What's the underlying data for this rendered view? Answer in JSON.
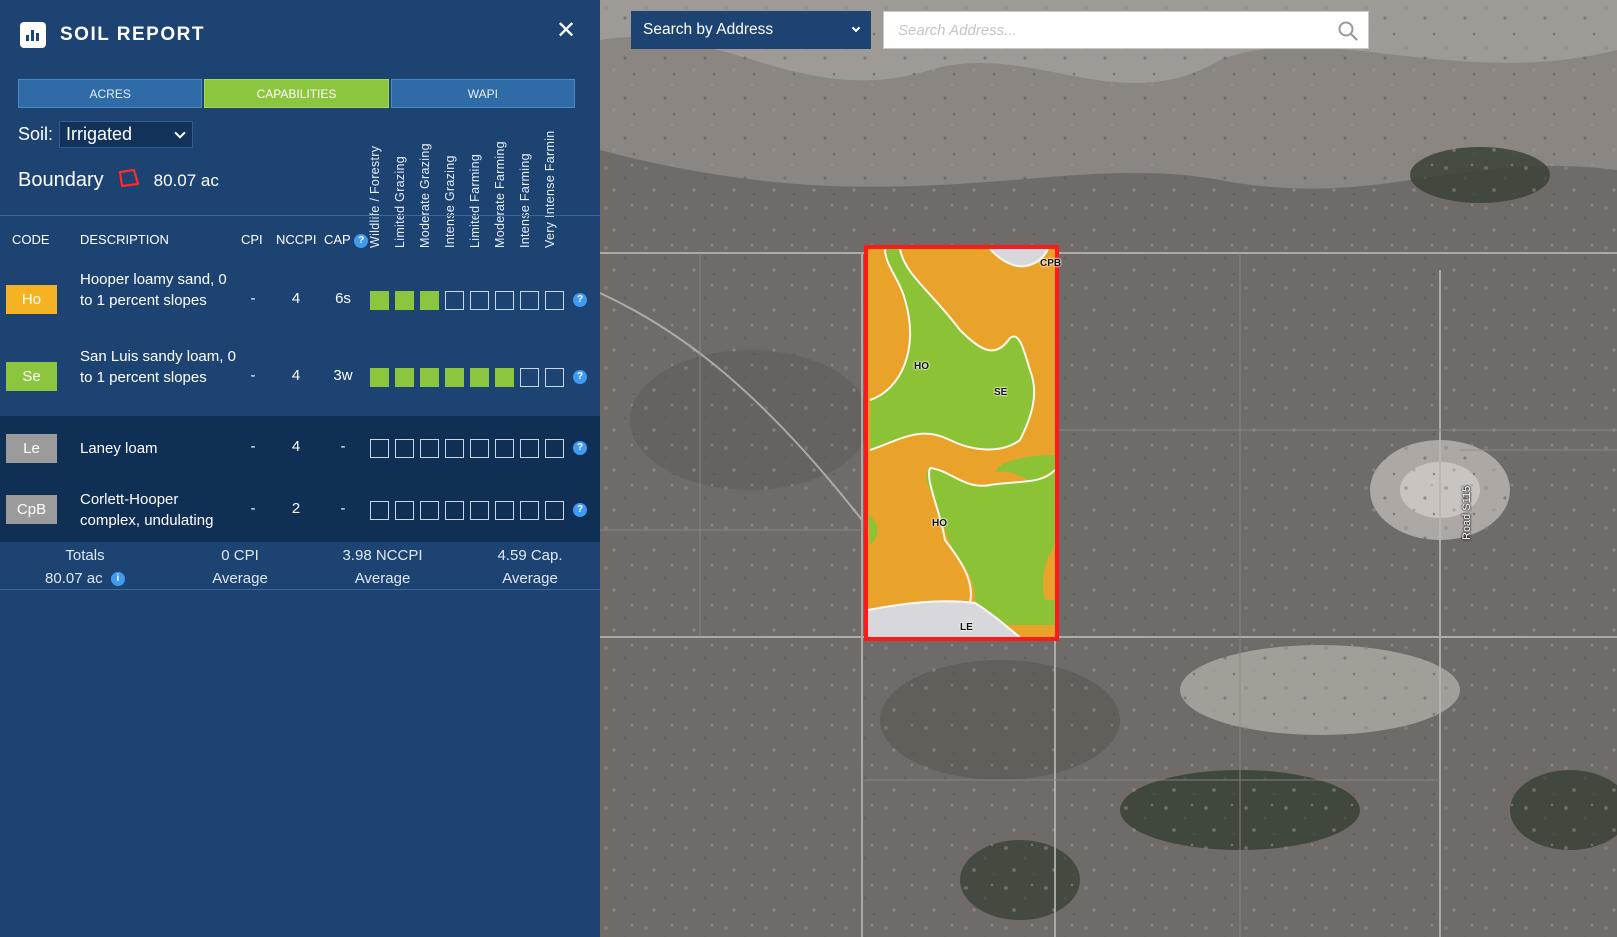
{
  "header": {
    "title": "SOIL REPORT",
    "close": "✕"
  },
  "tabs": [
    {
      "label": "ACRES",
      "active": false
    },
    {
      "label": "CAPABILITIES",
      "active": true
    },
    {
      "label": "WAPI",
      "active": false
    }
  ],
  "soil": {
    "label": "Soil:",
    "selected": "Irrigated"
  },
  "boundary": {
    "label": "Boundary",
    "value": "80.07 ac"
  },
  "capability_headers": [
    "Wildlife / Forestry",
    "Limited Grazing",
    "Moderate Grazing",
    "Intense Grazing",
    "Limited Farming",
    "Moderate Farming",
    "Intense Farming",
    "Very Intense Farmin"
  ],
  "columns": {
    "code": "CODE",
    "description": "DESCRIPTION",
    "cpi": "CPI",
    "nccpi": "NCCPI",
    "cap": "CAP"
  },
  "help_glyph": "?",
  "rows": [
    {
      "code": "Ho",
      "color": "#f5b324",
      "text_color": "#ffffff",
      "description": "Hooper loamy sand, 0 to 1 percent slopes",
      "cpi": "-",
      "nccpi": "4",
      "cap": "6s",
      "filled": 3,
      "dark": false
    },
    {
      "code": "Se",
      "color": "#8cc63f",
      "text_color": "#ffffff",
      "description": "San Luis sandy loam, 0 to 1 percent slopes",
      "cpi": "-",
      "nccpi": "4",
      "cap": "3w",
      "filled": 6,
      "dark": false
    },
    {
      "code": "Le",
      "color": "#9b9b9b",
      "text_color": "#ffffff",
      "description": "Laney loam",
      "cpi": "-",
      "nccpi": "4",
      "cap": "-",
      "filled": 0,
      "dark": true
    },
    {
      "code": "CpB",
      "color": "#9b9b9b",
      "text_color": "#ffffff",
      "description": "Corlett-Hooper complex, undulating",
      "cpi": "-",
      "nccpi": "2",
      "cap": "-",
      "filled": 0,
      "dark": true
    }
  ],
  "totals": {
    "label": "Totals",
    "acres": "80.07 ac",
    "info_glyph": "i",
    "cpi": "0 CPI",
    "cpi_sub": "Average",
    "nccpi": "3.98 NCCPI",
    "nccpi_sub": "Average",
    "cap": "4.59 Cap.",
    "cap_sub": "Average"
  },
  "search": {
    "type": "Search by Address",
    "placeholder": "Search Address..."
  },
  "map": {
    "road_label": "Road S115",
    "labels": {
      "cpb": "CPB",
      "ho_top": "HO",
      "se": "SE",
      "ho_bottom": "HO",
      "le": "LE"
    },
    "colors": {
      "ho": "#eaa32a",
      "se": "#8cc235",
      "gray": "#d8d8dc",
      "boundary": "#ff1a1a"
    }
  }
}
